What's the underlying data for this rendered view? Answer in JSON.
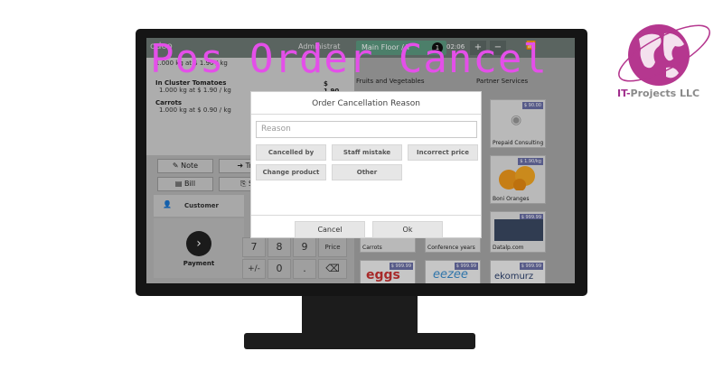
{
  "title": "Pos Order Cancel",
  "brand": {
    "prefix": "IT-",
    "name": "Projects LLC",
    "accent_color": "#a02d8c",
    "logo_icon": "globe-icon"
  },
  "pos": {
    "topbar": {
      "logo_text": "odoo",
      "user": "Administrat",
      "floor": "Main Floor / T",
      "guest_count": "1",
      "time": "02:06",
      "add_label": "+",
      "remove_label": "−"
    },
    "order_lines": [
      {
        "name": "",
        "detail": "1.000 kg at $ 1.90 / kg",
        "price": ""
      },
      {
        "name": "In Cluster Tomatoes",
        "detail": "1.000 kg at $ 1.90 / kg",
        "price": "$ 1.90"
      },
      {
        "name": "Carrots",
        "detail": "1.000 kg at $ 0.90 / kg",
        "price": ""
      }
    ],
    "actions": {
      "note": "Note",
      "transfer": "Tra",
      "bill": "Bill",
      "split": "S"
    },
    "customer_label": "Customer",
    "payment_label": "Payment",
    "numpad": {
      "k7": "7",
      "k8": "8",
      "k9": "9",
      "price": "Price",
      "plusminus": "+/-",
      "k0": "0",
      "dot": ".",
      "backspace": "⌫"
    },
    "categories": {
      "left": "Fruits and Vegetables",
      "right": "Partner Services"
    },
    "products": [
      {
        "name": "Prepaid Consulting",
        "price": "$ 90.00"
      },
      {
        "name": "Boni Oranges",
        "price": "$ 1.90/kg"
      },
      {
        "name": "Carrots",
        "price": ""
      },
      {
        "name": "Conference years",
        "price": ""
      },
      {
        "name": "Datalp.com",
        "price": "$ 999.99"
      },
      {
        "name": "eggs",
        "price": "$ 999.99"
      },
      {
        "name": "eezee",
        "price": "$ 999.99"
      },
      {
        "name": "ekomurz",
        "price": "$ 999.99"
      }
    ]
  },
  "modal": {
    "title": "Order Cancellation Reason",
    "input_placeholder": "Reason",
    "reasons": [
      "Cancelled by customer",
      "Staff mistake",
      "Incorrect price",
      "Change product",
      "Other"
    ],
    "cancel_label": "Cancel",
    "ok_label": "Ok"
  }
}
